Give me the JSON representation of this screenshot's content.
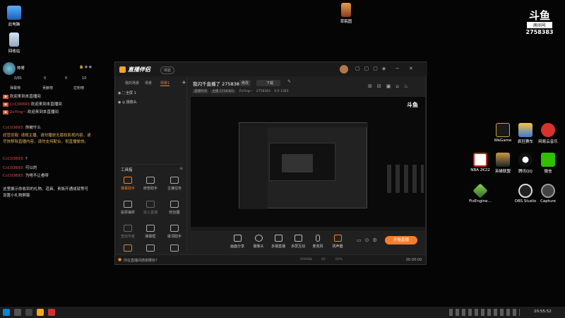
{
  "desktop_left": [
    {
      "label": "此电脑"
    },
    {
      "label": "回收站"
    }
  ],
  "desktop_top": {
    "label": "草稿图"
  },
  "room_logo": {
    "brand": "斗鱼",
    "sub": "房间号",
    "number": "2758383"
  },
  "desktop_right": [
    {
      "label": "WeGame"
    },
    {
      "label": "疯狂赛车"
    },
    {
      "label": "网易云音乐"
    },
    {
      "label": "NBA 2K22"
    },
    {
      "label": "英雄联盟"
    },
    {
      "label": "腾讯QQ"
    },
    {
      "label": "微信"
    },
    {
      "label": "FixEngine..."
    },
    {
      "label": "OBS Studio"
    },
    {
      "label": "Capture"
    }
  ],
  "chat": {
    "user": "帅哥",
    "counts": [
      "0/81",
      "0",
      "0",
      "10"
    ],
    "tabs": [
      "弹幕榜",
      "贡献榜",
      "拉粉榜"
    ],
    "lines": [
      {
        "name": "",
        "text": "欢迎来到本直播间"
      },
      {
        "name": "CcC00693:",
        "text": "欢迎来到本直播间"
      },
      {
        "name": "ZxYing~:",
        "text": "欢迎来到本直播间"
      },
      {
        "name": "CcC03693:",
        "text": "你被什么"
      },
      {
        "name": "超管提醒:",
        "text": "请规主播、请勿播放无版权影视内容，请尽快移除直播内容，请勿支持配合，祝直播愉快。"
      },
      {
        "name": "CcC03693:",
        "text": "?"
      },
      {
        "name": "CcC03693:",
        "text": "可以的"
      },
      {
        "name": "CcC03693:",
        "text": "为啥不让看呀"
      }
    ],
    "footer": "这里展示你收到的礼物、道具、贵族开通成就等可设置小礼物屏蔽"
  },
  "app": {
    "brand": "直播伴侣",
    "badge": "体验",
    "side_tabs": [
      "我的场景",
      "场景",
      "场景1"
    ],
    "sources": [
      "全屏 1",
      "摄像头"
    ],
    "toolbox_title": "工具箱",
    "tools": [
      "弹幕助手",
      "房管助手",
      "主播任务",
      "投票抽奖",
      "进入直播",
      "粉丝圈",
      "查找作者",
      "弹幕框",
      "歌词助手",
      "",
      "",
      ""
    ],
    "room_title": "我闪千直播了 2758383",
    "edit_label": "修改",
    "category": "下载",
    "room_meta": [
      "直播时间",
      "主播 2758383",
      "ZxYing~",
      "2758383",
      "0:0 1383"
    ],
    "bottom_buttons": [
      "画面分享",
      "摄像头",
      "多端直播",
      "多屏互动",
      "麦克风",
      "扬声器"
    ],
    "go_live": "开始直播",
    "bottom_tip": "你在直播间感谢哪些?",
    "stats": [
      "0000Kb",
      "00",
      "00%"
    ],
    "timer": "00:00:00"
  },
  "taskbar": {
    "time": "20:55:52"
  }
}
